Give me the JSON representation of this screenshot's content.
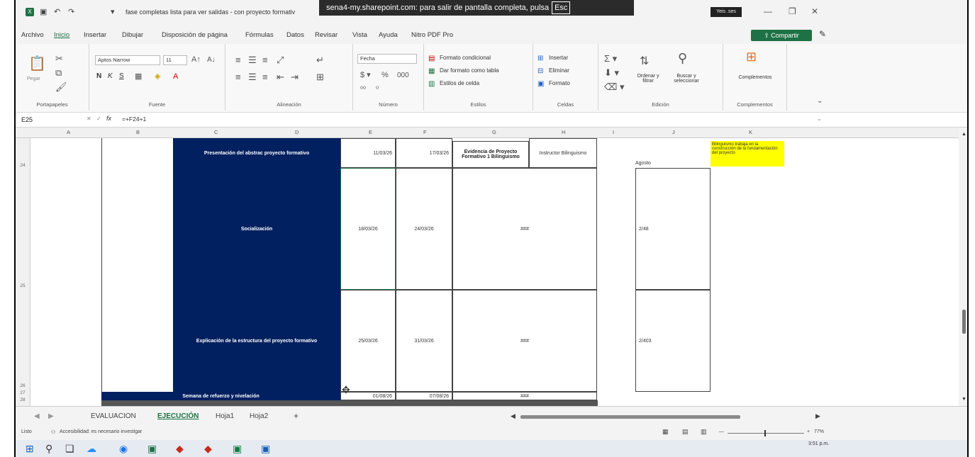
{
  "banner": {
    "text": "sena4-my.sharepoint.com: para salir de pantalla completa, pulsa",
    "key": "Esc"
  },
  "titlebar": {
    "document_title": "fase completas lista para ver salidas - con proyecto formativ",
    "user": "Yeis .ses"
  },
  "menu": [
    "Archivo",
    "Inicio",
    "Insertar",
    "Dibujar",
    "Disposición de página",
    "Fórmulas",
    "Datos",
    "Revisar",
    "Vista",
    "Ayuda",
    "Nitro PDF Pro"
  ],
  "share_label": "Compartir",
  "ribbon": {
    "clipboard": {
      "paste": "Pegar",
      "label": "Portapapeles"
    },
    "font": {
      "name": "Aptos Narrow",
      "size": "11",
      "bold": "N",
      "italic": "K",
      "underline": "S",
      "label": "Fuente"
    },
    "alignment": {
      "label": "Alineación"
    },
    "number": {
      "format": "Fecha",
      "label": "Número"
    },
    "styles": {
      "conditional": "Formato condicional",
      "as_table": "Dar formato como tabla",
      "cell_styles": "Estilos de celda",
      "label": "Estilos"
    },
    "cells": {
      "insert": "Insertar",
      "delete": "Eliminar",
      "format": "Formato",
      "label": "Celdas"
    },
    "editing": {
      "sort": "Ordenar y filtrar",
      "find": "Buscar y seleccionar",
      "label": "Edición"
    },
    "addins": {
      "item": "Complementos",
      "label": "Complementos"
    }
  },
  "formula_bar": {
    "cell": "E25",
    "fx": "fx",
    "formula": "=+F24+1"
  },
  "columns": [
    "A",
    "B",
    "C",
    "D",
    "E",
    "F",
    "G",
    "H",
    "I",
    "J",
    "K"
  ],
  "rows": {
    "r24": "24",
    "r25": "25",
    "r26": "26",
    "r27": "27",
    "r28": "28"
  },
  "sheet": {
    "row24": {
      "activity": "Presentación del abstrac proyecto formativo",
      "start": "11/03/26",
      "end": "17/03/26",
      "evidence": "Evidencia de Proyecto Formativo 1 Bilinguismo",
      "instructor": "Instructor Bilinguismo",
      "month": "Agosto",
      "note": "Bilinguismo trabaja en la construcción de la fundamentación del proyecto"
    },
    "row25a": {
      "activity": "Socialización",
      "start": "18/03/26",
      "end": "24/03/26",
      "evidence": "###",
      "hours": "2/48"
    },
    "row25b": {
      "activity": "Explicación de la estructura del proyecto formativo",
      "start": "25/03/26",
      "end": "31/03/26",
      "evidence": "###",
      "hours": "2/403"
    },
    "row26": {
      "activity": "Semana de refuerzo y nivelación",
      "start": "01/08/26",
      "end": "07/08/26",
      "evidence": "###"
    }
  },
  "tabs": [
    "EVALUACION",
    "EJECUCIÓN",
    "Hoja1",
    "Hoja2"
  ],
  "status": {
    "ready": "Listo",
    "accessibility": "Accesibilidad: es necesario investigar",
    "zoom": "77%"
  },
  "clock": {
    "time": "3:51 p.m."
  }
}
